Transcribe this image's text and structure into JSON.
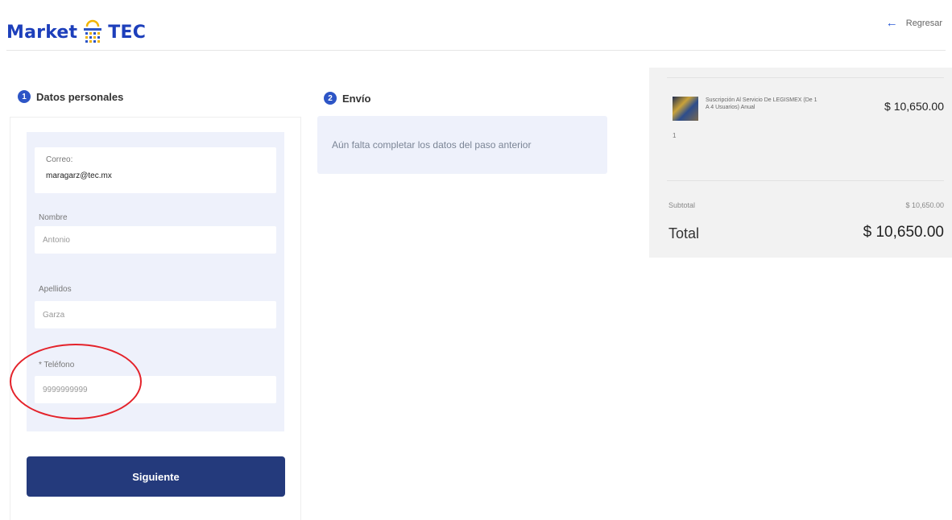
{
  "brand": {
    "left": "Market",
    "right": "TEC",
    "color": "#1d3fbb"
  },
  "header": {
    "back_label": "Regresar",
    "back_icon": "arrow-left-icon"
  },
  "steps": [
    {
      "number": "1",
      "title": "Datos personales"
    },
    {
      "number": "2",
      "title": "Envío"
    }
  ],
  "form": {
    "email_label": "Correo:",
    "email_value": "maragarz@tec.mx",
    "name_label": "Nombre",
    "name_value": "Antonio",
    "lastname_label": "Apellidos",
    "lastname_value": "Garza",
    "phone_label": "* Teléfono",
    "phone_value": "9999999999",
    "submit_label": "Siguiente"
  },
  "envio": {
    "message": "Aún falta completar los datos del paso anterior"
  },
  "summary": {
    "product_name": "Suscripción Al Servicio De LEGISMEX (De 1 A 4 Usuarios) Anual",
    "product_price": "$ 10,650.00",
    "quantity": "1",
    "subtotal_label": "Subtotal",
    "subtotal_value": "$ 10,650.00",
    "total_label": "Total",
    "total_value": "$ 10,650.00"
  },
  "colors": {
    "accent": "#2d55c6",
    "button": "#243a7c",
    "panel": "#eef1fb",
    "annotation": "#e4222a"
  }
}
